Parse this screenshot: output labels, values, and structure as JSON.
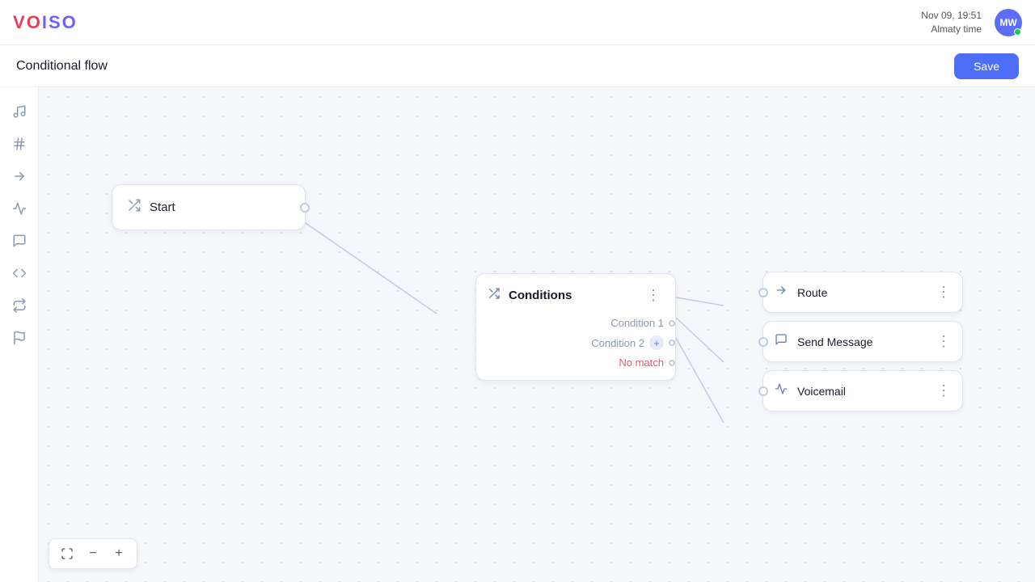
{
  "header": {
    "logo": "VOISO",
    "datetime": "Nov 09, 19:51",
    "timezone": "Almaty time",
    "avatar_initials": "MW"
  },
  "subheader": {
    "page_title": "Conditional flow",
    "save_label": "Save"
  },
  "sidebar": {
    "items": [
      {
        "id": "music",
        "icon": "♪",
        "label": "Music / Audio"
      },
      {
        "id": "hash",
        "icon": "#",
        "label": "DTMF / Keypad"
      },
      {
        "id": "route",
        "icon": "→",
        "label": "Route"
      },
      {
        "id": "wave",
        "icon": "≋",
        "label": "Voicemail"
      },
      {
        "id": "chat",
        "icon": "☰",
        "label": "Message"
      },
      {
        "id": "code",
        "icon": "</>",
        "label": "Code"
      },
      {
        "id": "transfer",
        "icon": "⇅",
        "label": "Transfer"
      },
      {
        "id": "flag",
        "icon": "⚑",
        "label": "Flag"
      }
    ]
  },
  "canvas": {
    "nodes": {
      "start": {
        "label": "Start"
      },
      "conditions": {
        "title": "Conditions",
        "condition1": "Condition 1",
        "condition2": "Condition 2",
        "no_match": "No match"
      },
      "route": {
        "label": "Route"
      },
      "send_message": {
        "label": "Send Message"
      },
      "voicemail": {
        "label": "Voicemail"
      }
    }
  },
  "zoom": {
    "fit_label": "fit",
    "minus_label": "−",
    "plus_label": "+"
  },
  "colors": {
    "accent": "#4f6ef7",
    "no_match": "#e05c72",
    "icon": "#6b7fab",
    "text_muted": "#8a9ab5"
  }
}
